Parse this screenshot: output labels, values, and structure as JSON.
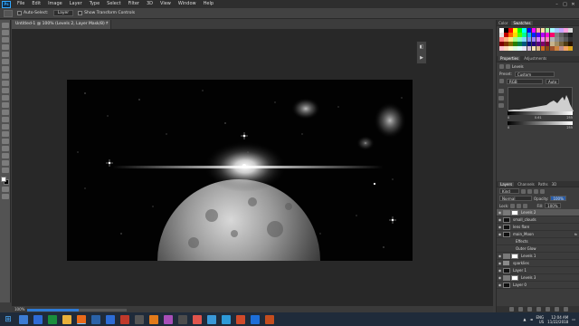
{
  "menu": {
    "logo": "Ps",
    "items": [
      "File",
      "Edit",
      "Image",
      "Layer",
      "Type",
      "Select",
      "Filter",
      "3D",
      "View",
      "Window",
      "Help"
    ]
  },
  "options": {
    "auto_select": "Auto-Select:",
    "layer_select": "Layer",
    "show_transform": "Show Transform Controls"
  },
  "document": {
    "tab_title": "Untitled-1 @ 100% (Levels 2, Layer Mask/8) *",
    "close": "×",
    "zoom": "100%"
  },
  "progress": {
    "fraction": 0.52
  },
  "panels": {
    "swatch_tabs": [
      "Color",
      "Swatches"
    ],
    "swatch_colors": [
      "#ffffff",
      "#000000",
      "#ff0000",
      "#ffff00",
      "#00ff00",
      "#00ffff",
      "#0000ff",
      "#ff00ff",
      "#ffa3a3",
      "#ffe0a3",
      "#a3ffa3",
      "#a3ffff",
      "#a3c8ff",
      "#c8a3ff",
      "#ffa3e0",
      "#d9d9d9",
      "#e6e6e6",
      "#c00000",
      "#ff6a00",
      "#ffd800",
      "#4cff00",
      "#00ff90",
      "#00b2ff",
      "#0026ff",
      "#4800ff",
      "#b200ff",
      "#ff00dc",
      "#ff006e",
      "#808080",
      "#606060",
      "#404040",
      "#202020",
      "#ff7f7f",
      "#ffb27f",
      "#ffe97f",
      "#a5ff7f",
      "#7fffc5",
      "#7fd8ff",
      "#7f92ff",
      "#a17fff",
      "#d67fff",
      "#ff7fed",
      "#ff7fb6",
      "#b3b3b3",
      "#8c8c8c",
      "#737373",
      "#595959",
      "#333333",
      "#7f0000",
      "#7f3300",
      "#7f6a00",
      "#267f00",
      "#007f46",
      "#00577f",
      "#00137f",
      "#24007f",
      "#57007f",
      "#7f006e",
      "#7f0037",
      "#c8b48c",
      "#a08c64",
      "#78643c",
      "#503c14",
      "#281400",
      "#ffc0cb",
      "#ffdab9",
      "#fffacd",
      "#e0ffe0",
      "#e0ffff",
      "#e6e6fa",
      "#d8bfd8",
      "#f5deb3",
      "#deb887",
      "#d2691e",
      "#8b4513",
      "#a0522d",
      "#cd853f",
      "#bc8f8f",
      "#f4a460",
      "#daa520"
    ],
    "props_tabs": [
      "Properties",
      "Adjustments"
    ],
    "props_title": "Levels",
    "preset_label": "Preset:",
    "preset_value": "Custom",
    "channel": "RGB",
    "auto": "Auto",
    "levels_values": [
      "0",
      "0.61",
      "255"
    ],
    "output_values": [
      "0",
      "255"
    ],
    "layers_tabs": [
      "Layers",
      "Channels",
      "Paths",
      "3D"
    ],
    "kind": "Kind",
    "blend_mode": "Normal",
    "opacity_label": "Opacity:",
    "opacity_value": "100%",
    "lock_label": "Lock:",
    "fill_label": "Fill:",
    "fill_value": "100%",
    "layers": [
      {
        "name": "Levels 2",
        "kind": "adj",
        "selected": true
      },
      {
        "name": "small_clouds",
        "kind": "img",
        "selected": false
      },
      {
        "name": "lens flare",
        "kind": "img",
        "selected": false
      },
      {
        "name": "main_Moon",
        "kind": "img",
        "selected": false,
        "fx": "fx"
      },
      {
        "name": "Effects",
        "kind": "sub",
        "selected": false
      },
      {
        "name": "Outer Glow",
        "kind": "sub",
        "selected": false
      },
      {
        "name": "Levels 1",
        "kind": "adj",
        "selected": false
      },
      {
        "name": "sparklies",
        "kind": "folder",
        "selected": false
      },
      {
        "name": "Layer 1",
        "kind": "img",
        "selected": false
      },
      {
        "name": "Levels 3",
        "kind": "adj",
        "selected": false
      },
      {
        "name": "Layer 0",
        "kind": "img",
        "selected": false
      }
    ]
  },
  "taskbar": {
    "apps": [
      "#3c7cd4",
      "#2e6bd6",
      "#1a8f3c",
      "#e8b13a",
      "#e96a1a",
      "#2a62a8",
      "#2d6cd6",
      "#c0392b",
      "#555555",
      "#e27a1a",
      "#a84eb8",
      "#4c4c4c",
      "#e0544c",
      "#3a99d8",
      "#2d9ad8",
      "#d04a2a",
      "#1d6ed8",
      "#c44d1e"
    ],
    "lang": "ENG",
    "region": "US",
    "time": "12:04 AM",
    "date": "11/22/2018"
  }
}
